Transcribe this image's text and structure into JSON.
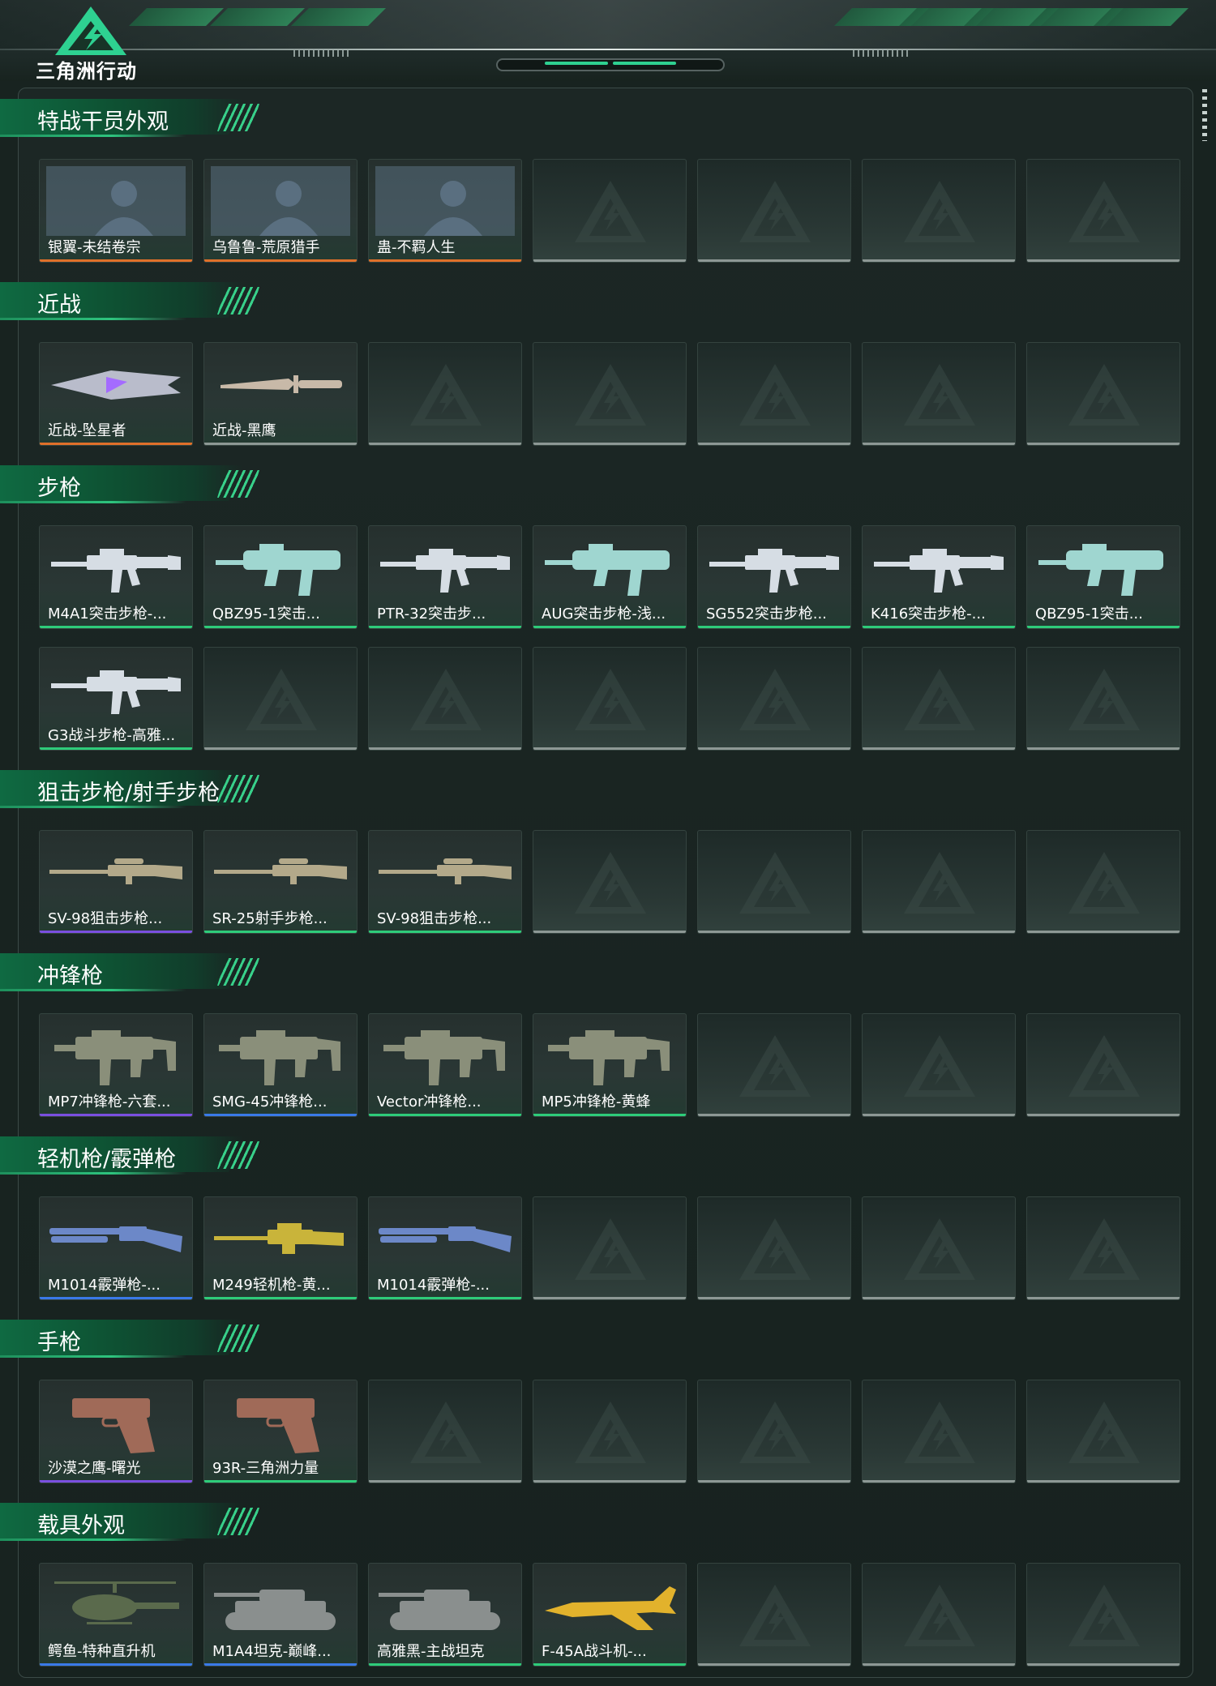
{
  "brand": {
    "logo_text": "三角洲行动"
  },
  "colors": {
    "orange": "#e0702a",
    "gold": "#e08a2a",
    "green": "#2ecc7a",
    "purple": "#7a4fe0",
    "blue": "#3a7ae8",
    "gray": "#8d9895"
  },
  "sections": [
    {
      "title": "特战干员外观",
      "items": [
        {
          "name": "银翼-未结卷宗",
          "rarity": "orange",
          "icon": "operator-portrait"
        },
        {
          "name": "乌鲁鲁-荒原猎手",
          "rarity": "orange",
          "icon": "operator-portrait"
        },
        {
          "name": "蛊-不羁人生",
          "rarity": "orange",
          "icon": "operator-portrait"
        }
      ]
    },
    {
      "title": "近战",
      "items": [
        {
          "name": "近战-坠星者",
          "rarity": "orange",
          "icon": "blade"
        },
        {
          "name": "近战-黑鹰",
          "rarity": "gray",
          "icon": "knife"
        }
      ]
    },
    {
      "title": "步枪",
      "items": [
        {
          "name": "M4A1突击步枪-...",
          "rarity": "green",
          "icon": "rifle"
        },
        {
          "name": "QBZ95-1突击...",
          "rarity": "green",
          "icon": "bullpup-rifle"
        },
        {
          "name": "PTR-32突击步...",
          "rarity": "green",
          "icon": "rifle"
        },
        {
          "name": "AUG突击步枪-浅...",
          "rarity": "green",
          "icon": "bullpup-rifle"
        },
        {
          "name": "SG552突击步枪...",
          "rarity": "green",
          "icon": "rifle"
        },
        {
          "name": "K416突击步枪-...",
          "rarity": "green",
          "icon": "rifle"
        },
        {
          "name": "QBZ95-1突击...",
          "rarity": "green",
          "icon": "bullpup-rifle"
        },
        {
          "name": "G3战斗步枪-高雅...",
          "rarity": "green",
          "icon": "rifle"
        }
      ]
    },
    {
      "title": "狙击步枪/射手步枪",
      "items": [
        {
          "name": "SV-98狙击步枪...",
          "rarity": "purple",
          "icon": "sniper-rifle"
        },
        {
          "name": "SR-25射手步枪...",
          "rarity": "green",
          "icon": "sniper-rifle"
        },
        {
          "name": "SV-98狙击步枪...",
          "rarity": "green",
          "icon": "sniper-rifle"
        }
      ]
    },
    {
      "title": "冲锋枪",
      "items": [
        {
          "name": "MP7冲锋枪-六套...",
          "rarity": "purple",
          "icon": "smg"
        },
        {
          "name": "SMG-45冲锋枪...",
          "rarity": "blue",
          "icon": "smg"
        },
        {
          "name": "Vector冲锋枪...",
          "rarity": "green",
          "icon": "smg"
        },
        {
          "name": "MP5冲锋枪-黄蜂",
          "rarity": "green",
          "icon": "smg"
        }
      ]
    },
    {
      "title": "轻机枪/霰弹枪",
      "items": [
        {
          "name": "M1014霰弹枪-...",
          "rarity": "blue",
          "icon": "shotgun"
        },
        {
          "name": "M249轻机枪-黄...",
          "rarity": "green",
          "icon": "lmg"
        },
        {
          "name": "M1014霰弹枪-...",
          "rarity": "green",
          "icon": "shotgun"
        }
      ]
    },
    {
      "title": "手枪",
      "items": [
        {
          "name": "沙漠之鹰-曙光",
          "rarity": "purple",
          "icon": "pistol"
        },
        {
          "name": "93R-三角洲力量",
          "rarity": "green",
          "icon": "pistol"
        }
      ]
    },
    {
      "title": "载具外观",
      "items": [
        {
          "name": "鳄鱼-特种直升机",
          "rarity": "blue",
          "icon": "helicopter"
        },
        {
          "name": "M1A4坦克-巅峰...",
          "rarity": "blue",
          "icon": "tank"
        },
        {
          "name": "高雅黑-主战坦克",
          "rarity": "green",
          "icon": "tank"
        },
        {
          "name": "F-45A战斗机-...",
          "rarity": "green",
          "icon": "jet"
        }
      ]
    }
  ]
}
